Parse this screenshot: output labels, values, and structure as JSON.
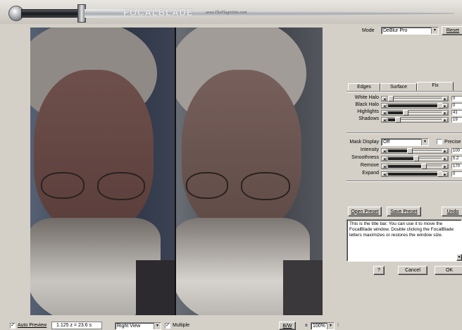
{
  "app": {
    "logo": "FOCALBLADE",
    "site": "www.ThePluginSite.com"
  },
  "header": {
    "mode_label": "Mode",
    "mode_value": "DeBlur Pro",
    "reset_label": "Reset"
  },
  "tabs": [
    {
      "label": "Edges"
    },
    {
      "label": "Surface"
    },
    {
      "label": "Fix"
    }
  ],
  "fix": {
    "sliders": [
      {
        "label": "White Halo",
        "value": "0",
        "level": 0.0
      },
      {
        "label": "Black Halo",
        "value": "0",
        "level": 1.0
      },
      {
        "label": "Highlights",
        "value": "41",
        "level": 0.3
      },
      {
        "label": "Shadows",
        "value": "19",
        "level": 0.14
      }
    ]
  },
  "mask": {
    "display_label": "Mask Display",
    "display_value": "Off",
    "precise_label": "Precise",
    "sliders": [
      {
        "label": "Intensity",
        "value": "100",
        "level": 0.39
      },
      {
        "label": "Smoothness",
        "value": "5.2",
        "level": 0.52
      },
      {
        "label": "Remove",
        "value": "170",
        "level": 0.67
      },
      {
        "label": "Expand",
        "value": "0",
        "level": 1.0
      }
    ]
  },
  "presets": {
    "open": "Open Preset",
    "save": "Save Preset",
    "undo": "Undo"
  },
  "help_text": "This is the title bar. You can use it to move the FocalBlade window. Double clicking the FocalBlade letters maximizes or restores the window size.",
  "dialog": {
    "help": "?",
    "cancel": "Cancel",
    "ok": "OK"
  },
  "status": {
    "auto_preview_label": "Auto Preview",
    "auto_preview_checked": true,
    "coords": "1.125 z = 23.6 s",
    "view_value": "Right View",
    "multiple_label": "Multiple",
    "multiple_checked": true,
    "bw_label": "B/W",
    "zoom_minus": "±",
    "zoom_value": "100%"
  },
  "colors": {
    "bg": "#d4d0c8",
    "accent": "#000080"
  }
}
